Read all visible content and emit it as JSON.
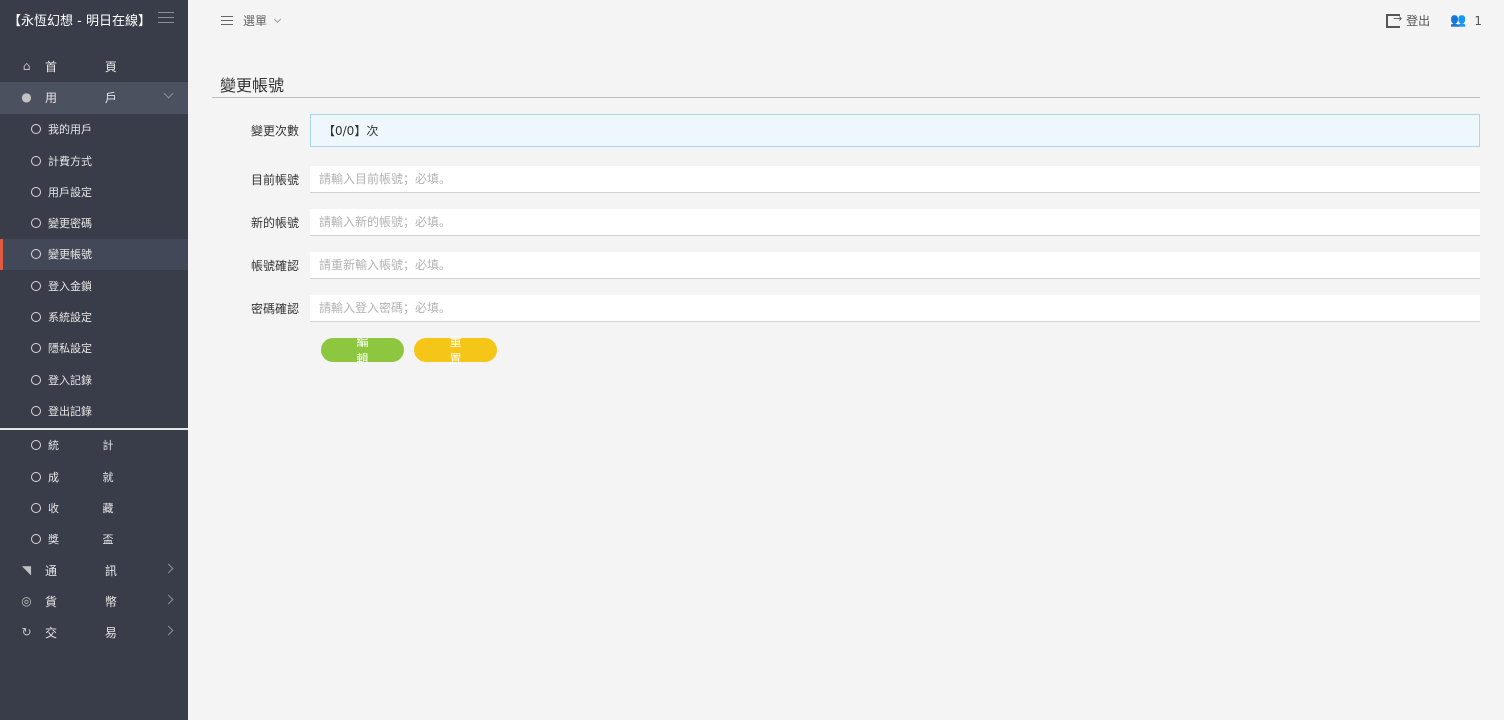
{
  "brand": {
    "title": "【永恆幻想 - 明日在線】"
  },
  "header": {
    "menu_label": "選單",
    "logout_label": "登出",
    "online_count": "1"
  },
  "sidebar": {
    "items": [
      {
        "label": "首 頁",
        "icon": "home-icon",
        "type": "top"
      },
      {
        "label": "用 戶",
        "icon": "user-icon",
        "type": "top",
        "expanded": true
      },
      {
        "label": "我的用戶",
        "type": "sub"
      },
      {
        "label": "計費方式",
        "type": "sub"
      },
      {
        "label": "用戶設定",
        "type": "sub"
      },
      {
        "label": "變更密碼",
        "type": "sub"
      },
      {
        "label": "變更帳號",
        "type": "sub",
        "current": true
      },
      {
        "label": "登入金鎖",
        "type": "sub"
      },
      {
        "label": "系統設定",
        "type": "sub"
      },
      {
        "label": "隱私設定",
        "type": "sub"
      },
      {
        "label": "登入記錄",
        "type": "sub"
      },
      {
        "label": "登出記錄",
        "type": "sub"
      },
      {
        "label": "統 計",
        "type": "sub"
      },
      {
        "label": "成 就",
        "type": "sub"
      },
      {
        "label": "收 藏",
        "type": "sub"
      },
      {
        "label": "獎 盃",
        "type": "sub"
      },
      {
        "label": "通 訊",
        "icon": "megaphone-icon",
        "type": "top"
      },
      {
        "label": "貨 幣",
        "icon": "currency-icon",
        "type": "top"
      },
      {
        "label": "交 易",
        "icon": "exchange-icon",
        "type": "top"
      }
    ]
  },
  "main": {
    "title": "變更帳號",
    "change_count": {
      "label": "變更次數",
      "value": "【0/0】次"
    },
    "current_account": {
      "label": "目前帳號",
      "placeholder": "請輸入目前帳號；必填。"
    },
    "new_account": {
      "label": "新的帳號",
      "placeholder": "請輸入新的帳號；必填。"
    },
    "confirm_account": {
      "label": "帳號確認",
      "placeholder": "請重新輸入帳號；必填。"
    },
    "password_confirm": {
      "label": "密碼確認",
      "placeholder": "請輸入登入密碼；必填。"
    },
    "edit_button": "編 輯",
    "reset_button": "重 置"
  },
  "colors": {
    "sidebar_bg": "#393d49",
    "edit_btn": "#8dc63f",
    "reset_btn": "#f5c518",
    "active_marker": "#e35b3f"
  }
}
